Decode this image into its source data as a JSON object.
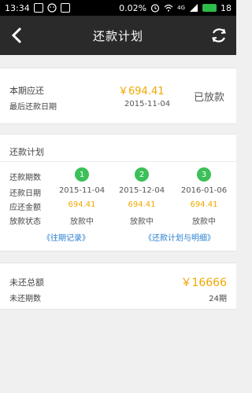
{
  "status_bar": {
    "time": "13:34",
    "battery_percent": "0.02%",
    "network": "4G",
    "battery_level": "18"
  },
  "header": {
    "title": "还款计划"
  },
  "summary": {
    "current_due_label": "本期应还",
    "last_due_date_label": "最后还款日期",
    "amount": "￥694.41",
    "date": "2015-11-04",
    "status": "已放款"
  },
  "plan": {
    "title": "还款计划",
    "row_labels": {
      "period": "还款期数",
      "date": "还款日期",
      "amount": "应还金额",
      "status": "放款状态"
    },
    "periods": [
      {
        "number": "1",
        "date": "2015-11-04",
        "amount": "694.41",
        "status": "放款中"
      },
      {
        "number": "2",
        "date": "2015-12-04",
        "amount": "694.41",
        "status": "放款中"
      },
      {
        "number": "3",
        "date": "2016-01-06",
        "amount": "694.41",
        "status": "放款中"
      }
    ],
    "prev_link": "《往期记录》",
    "next_link": "《还款计划与明细》"
  },
  "remaining": {
    "total_label": "未还总额",
    "periods_label": "未还期数",
    "amount": "￥16666",
    "periods": "24期"
  },
  "colors": {
    "accent": "#f0a800",
    "badge": "#3cc05a",
    "link": "#2a7fd1",
    "navbar": "#2a2a2a"
  }
}
